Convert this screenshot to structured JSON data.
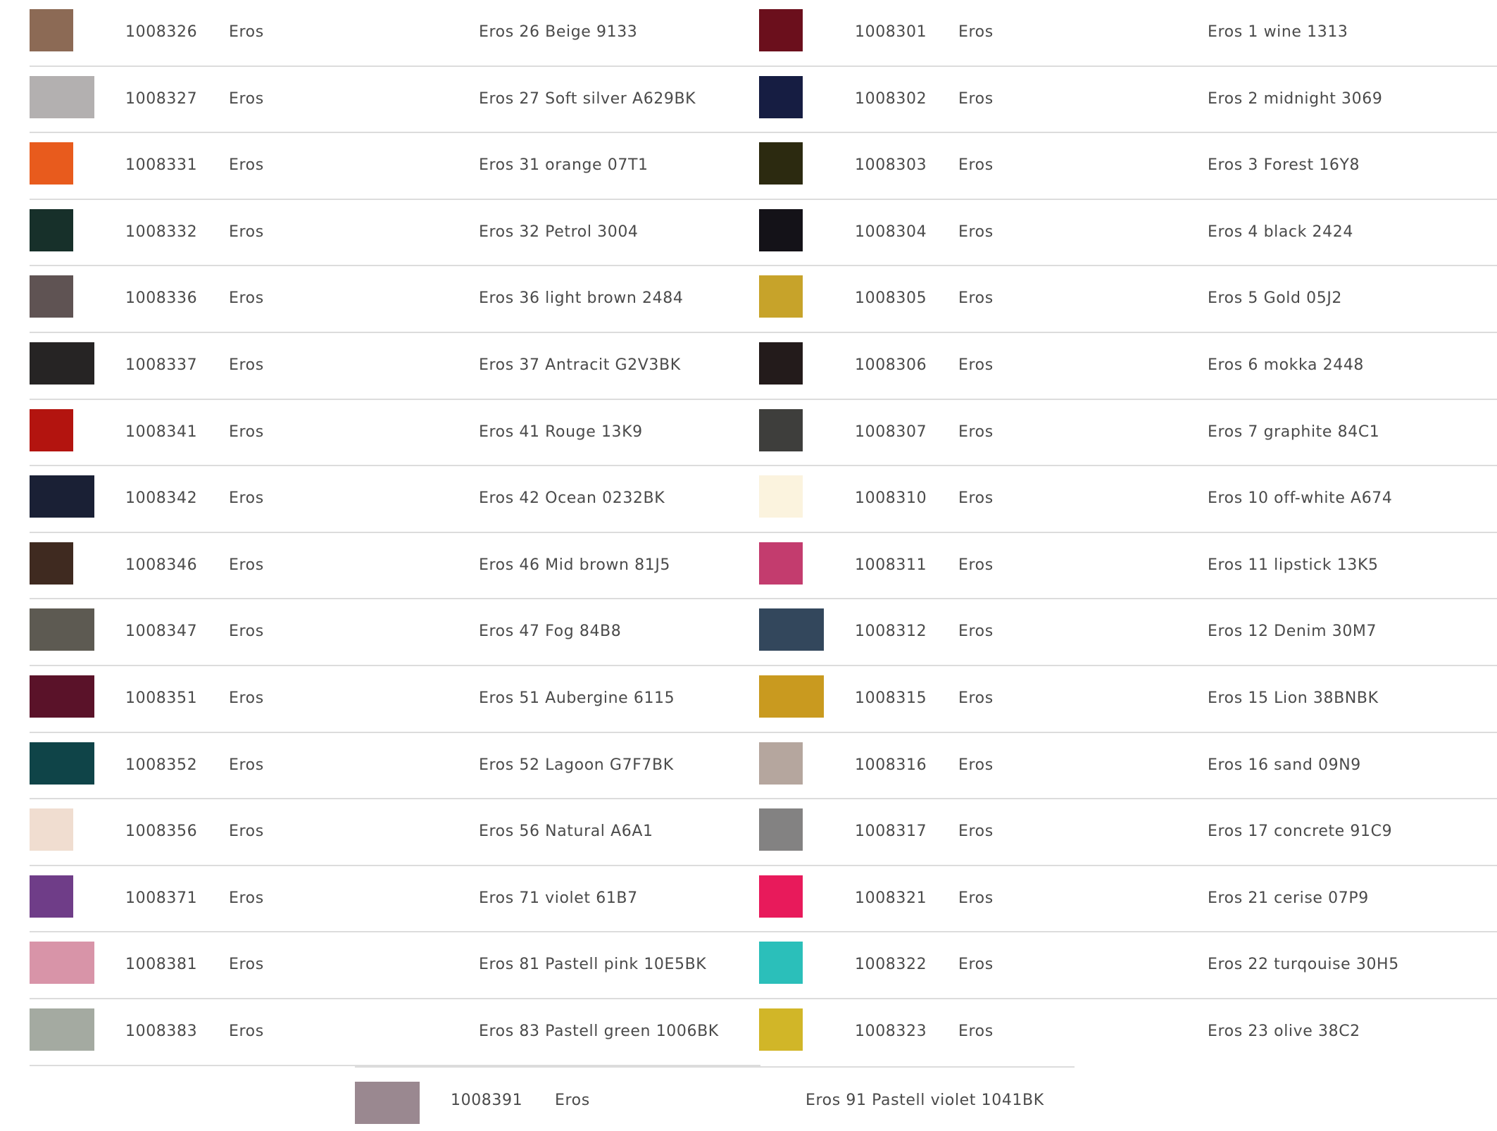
{
  "left_column": [
    {
      "code": "1008326",
      "brand": "Eros",
      "description": "Eros 26 Beige 9133",
      "color": "#8c6a55"
    },
    {
      "code": "1008327",
      "brand": "Eros",
      "description": "Eros 27 Soft silver A629BK",
      "color": "#b3b0b0"
    },
    {
      "code": "1008331",
      "brand": "Eros",
      "description": "Eros 31 orange 07T1",
      "color": "#e85b1d"
    },
    {
      "code": "1008332",
      "brand": "Eros",
      "description": "Eros 32 Petrol 3004",
      "color": "#17302a"
    },
    {
      "code": "1008336",
      "brand": "Eros",
      "description": "Eros 36 light brown 2484",
      "color": "#5f5353"
    },
    {
      "code": "1008337",
      "brand": "Eros",
      "description": "Eros 37 Antracit G2V3BK",
      "color": "#262424"
    },
    {
      "code": "1008341",
      "brand": "Eros",
      "description": "Eros 41 Rouge 13K9",
      "color": "#b3140f"
    },
    {
      "code": "1008342",
      "brand": "Eros",
      "description": "Eros 42 Ocean 0232BK",
      "color": "#1a2035"
    },
    {
      "code": "1008346",
      "brand": "Eros",
      "description": "Eros 46 Mid brown 81J5",
      "color": "#3f2a20"
    },
    {
      "code": "1008347",
      "brand": "Eros",
      "description": "Eros 47 Fog 84B8",
      "color": "#5d5a52"
    },
    {
      "code": "1008351",
      "brand": "Eros",
      "description": "Eros 51 Aubergine 6115",
      "color": "#5a1229"
    },
    {
      "code": "1008352",
      "brand": "Eros",
      "description": "Eros 52 Lagoon G7F7BK",
      "color": "#0f4448"
    },
    {
      "code": "1008356",
      "brand": "Eros",
      "description": "Eros 56 Natural A6A1",
      "color": "#f0ddd0"
    },
    {
      "code": "1008371",
      "brand": "Eros",
      "description": "Eros 71 violet 61B7",
      "color": "#6f3d88"
    },
    {
      "code": "1008381",
      "brand": "Eros",
      "description": "Eros 81 Pastell pink 10E5BK",
      "color": "#d894a8"
    },
    {
      "code": "1008383",
      "brand": "Eros",
      "description": "Eros 83 Pastell green 1006BK",
      "color": "#a4aaa1"
    }
  ],
  "right_column": [
    {
      "code": "1008301",
      "brand": "Eros",
      "description": "Eros 1 wine 1313",
      "color": "#6b0f1c"
    },
    {
      "code": "1008302",
      "brand": "Eros",
      "description": "Eros 2 midnight 3069",
      "color": "#161d42"
    },
    {
      "code": "1008303",
      "brand": "Eros",
      "description": "Eros 3 Forest 16Y8",
      "color": "#2c2a10"
    },
    {
      "code": "1008304",
      "brand": "Eros",
      "description": "Eros 4 black 2424",
      "color": "#141218"
    },
    {
      "code": "1008305",
      "brand": "Eros",
      "description": "Eros 5 Gold 05J2",
      "color": "#c7a32a"
    },
    {
      "code": "1008306",
      "brand": "Eros",
      "description": "Eros 6 mokka 2448",
      "color": "#231b1b"
    },
    {
      "code": "1008307",
      "brand": "Eros",
      "description": "Eros 7 graphite 84C1",
      "color": "#3e3e3c"
    },
    {
      "code": "1008310",
      "brand": "Eros",
      "description": "Eros 10 off-white A674",
      "color": "#fbf3de"
    },
    {
      "code": "1008311",
      "brand": "Eros",
      "description": "Eros 11 lipstick 13K5",
      "color": "#c33c6e"
    },
    {
      "code": "1008312",
      "brand": "Eros",
      "description": "Eros 12 Denim 30M7",
      "color": "#33475c"
    },
    {
      "code": "1008315",
      "brand": "Eros",
      "description": "Eros 15 Lion 38BNBK",
      "color": "#c99a1f"
    },
    {
      "code": "1008316",
      "brand": "Eros",
      "description": "Eros 16 sand 09N9",
      "color": "#b5a69e"
    },
    {
      "code": "1008317",
      "brand": "Eros",
      "description": "Eros 17 concrete 91C9",
      "color": "#838282"
    },
    {
      "code": "1008321",
      "brand": "Eros",
      "description": "Eros 21 cerise 07P9",
      "color": "#e81a5b"
    },
    {
      "code": "1008322",
      "brand": "Eros",
      "description": "Eros 22 turqouise 30H5",
      "color": "#2bbfba"
    },
    {
      "code": "1008323",
      "brand": "Eros",
      "description": "Eros 23 olive 38C2",
      "color": "#d1b628"
    }
  ],
  "extra_row": {
    "code": "1008391",
    "brand": "Eros",
    "description": "Eros 91 Pastell violet 1041BK",
    "color": "#9a8890"
  }
}
